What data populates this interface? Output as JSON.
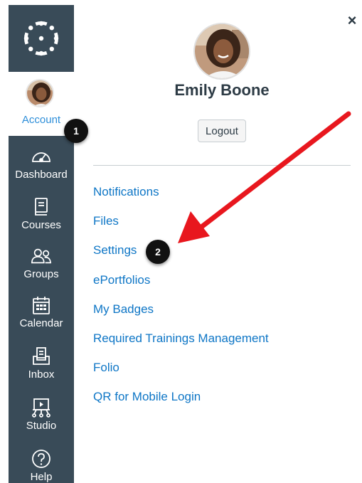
{
  "nav": {
    "account_label": "Account",
    "items": [
      {
        "label": "Dashboard",
        "icon": "dashboard-icon"
      },
      {
        "label": "Courses",
        "icon": "courses-icon"
      },
      {
        "label": "Groups",
        "icon": "groups-icon"
      },
      {
        "label": "Calendar",
        "icon": "calendar-icon"
      },
      {
        "label": "Inbox",
        "icon": "inbox-icon"
      },
      {
        "label": "Studio",
        "icon": "studio-icon"
      },
      {
        "label": "Help",
        "icon": "help-icon"
      }
    ]
  },
  "tray": {
    "close_symbol": "×",
    "user_name": "Emily Boone",
    "logout_label": "Logout",
    "links": [
      "Notifications",
      "Files",
      "Settings",
      "ePortfolios",
      "My Badges",
      "Required Trainings Management",
      "Folio",
      "QR for Mobile Login"
    ]
  },
  "callouts": {
    "one": "1",
    "two": "2"
  },
  "colors": {
    "nav_background": "#394b58",
    "active_label": "#2d8ed9",
    "link": "#0e76c6",
    "arrow": "#e8171e"
  }
}
